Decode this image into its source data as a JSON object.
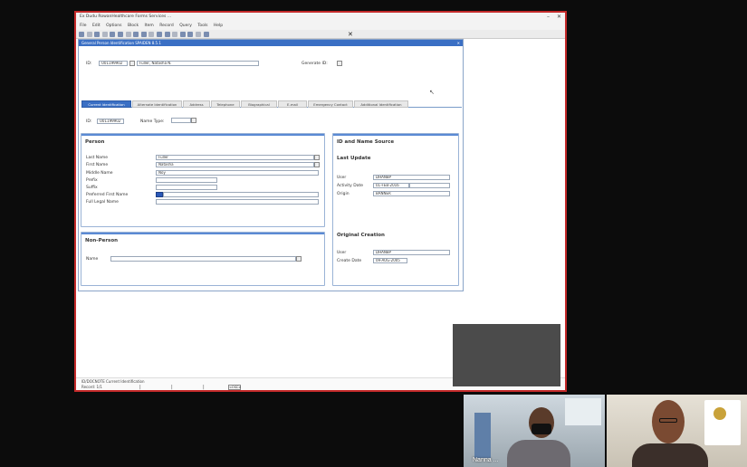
{
  "window": {
    "title": "Ex Dudu RowanHealthcare Forms Services ...",
    "controls": [
      "–",
      "✕"
    ]
  },
  "menubar": {
    "items": [
      "File",
      "Edit",
      "Options",
      "Block",
      "Item",
      "Record",
      "Query",
      "Tools",
      "Help"
    ]
  },
  "form": {
    "title": "General Person Identification  SPAIDEN  8.5.1",
    "close": "✕",
    "id_label": "ID:",
    "id_value": "U01199902",
    "name_value": "Fuller, Natasha N.",
    "generate_id_label": "Generate ID:",
    "tabs": [
      "Current Identification",
      "Alternate Identification",
      "Address",
      "Telephone",
      "Biographical",
      "E-mail",
      "Emergency Contact",
      "Additional Identification"
    ],
    "id_row_label": "ID:",
    "id_row_value": "U01199902",
    "name_type_label": "Name Type:"
  },
  "person": {
    "title": "Person",
    "last_name_label": "Last Name",
    "last_name_value": "Fuller",
    "first_name_label": "First Name",
    "first_name_value": "Natasha",
    "middle_name_label": "Middle Name",
    "middle_name_value": "Noy",
    "prefix_label": "Prefix",
    "suffix_label": "Suffix",
    "preferred_label": "Preferred First Name",
    "full_legal_label": "Full Legal Name"
  },
  "non_person": {
    "title": "Non-Person",
    "name_label": "Name"
  },
  "source": {
    "title": "ID and Name Source",
    "last_update": "Last Update",
    "user_label": "User",
    "user_value": "DHANBP",
    "activity_label": "Activity Date",
    "activity_value": "01-FEB-2016",
    "origin_label": "Origin",
    "origin_value": "BANNER",
    "original_creation": "Original Creation",
    "user2_label": "User",
    "user2_value": "DHANBP",
    "create_label": "Create Date",
    "create_value": "09-AUG-2005"
  },
  "status": {
    "line1": "ID/DOCNOTE  Current Identification",
    "line2": "Record: 1/1",
    "box": "<OSC>"
  },
  "video": {
    "participant1": "Nanna ...",
    "participant2": ""
  }
}
